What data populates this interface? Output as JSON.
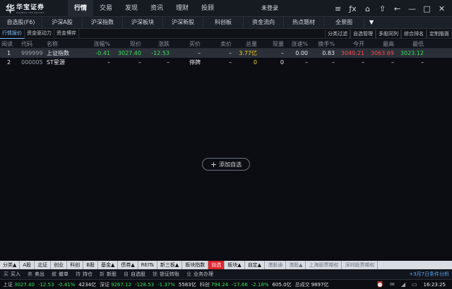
{
  "app": {
    "logo_mark": "华",
    "logo_cn": "华宝证券",
    "logo_en": "HUABAO SECURITIES"
  },
  "top_nav": [
    {
      "label": "行情",
      "active": true
    },
    {
      "label": "交易"
    },
    {
      "label": "发现"
    },
    {
      "label": "资讯"
    },
    {
      "label": "理财"
    },
    {
      "label": "投顾"
    }
  ],
  "login_label": "未登录",
  "window_icons": [
    "≡",
    "ƒx",
    "⌂",
    "⇧",
    "←",
    "—",
    "□",
    "✕"
  ],
  "categories": [
    "自选股(F6)",
    "沪深A股",
    "沪深指数",
    "沪深板块",
    "沪深新股",
    "科创板",
    "资金流向",
    "热点题材",
    "全景图"
  ],
  "category_more": "▼",
  "sub_tabs": [
    "行情报价",
    "资金驱动力",
    "资金博弈"
  ],
  "sub_right": [
    "分类过滤",
    "自选管理",
    "多股同列",
    "综合排名",
    "定制版面"
  ],
  "table": {
    "headers": [
      "阅读",
      "代码",
      "名称",
      "涨幅%",
      "现价",
      "涨跌",
      "买价",
      "卖价",
      "总量",
      "现量",
      "涨速%",
      "换手%",
      "今开",
      "最高",
      "最低"
    ],
    "rows": [
      {
        "idx": "1",
        "code": "999999",
        "name": "上证指数",
        "chg_pct": "-0.41",
        "price": "3027.40",
        "change": "-12.53",
        "bid": "–",
        "ask": "–",
        "volume": "3.77亿",
        "cur_vol": "–",
        "speed": "0.00",
        "turnover": "0.83",
        "open": "3040.21",
        "high": "3063.69",
        "low": "3023.12"
      },
      {
        "idx": "2",
        "code": "000005",
        "name": "ST星源",
        "chg_pct": "–",
        "price": "–",
        "change": "–",
        "bid": "停牌",
        "ask": "–",
        "volume": "0",
        "cur_vol": "0",
        "speed": "–",
        "turnover": "–",
        "open": "–",
        "high": "–",
        "low": "–"
      }
    ]
  },
  "add_watch_label": "添加自选",
  "bottom_tabs": [
    {
      "label": "分类▲"
    },
    {
      "label": "A股"
    },
    {
      "label": "北证"
    },
    {
      "label": "创业"
    },
    {
      "label": "科创"
    },
    {
      "label": "B股"
    },
    {
      "label": "基金▲"
    },
    {
      "label": "债券▲"
    },
    {
      "label": "REITs"
    },
    {
      "label": "新三板▲"
    },
    {
      "label": "板块指数"
    },
    {
      "label": "自选",
      "active": true
    },
    {
      "label": "板块▲"
    },
    {
      "label": "自定▲"
    },
    {
      "label": "港股通",
      "muted": true
    },
    {
      "label": "港股▲",
      "muted": true
    },
    {
      "label": "上海股票期权",
      "muted": true
    },
    {
      "label": "深圳股票期权",
      "muted": true
    }
  ],
  "toolbar": [
    {
      "icon": "买",
      "label": "买入"
    },
    {
      "icon": "卖",
      "label": "卖出"
    },
    {
      "icon": "撤",
      "label": "撤单"
    },
    {
      "icon": "持",
      "label": "持仓"
    },
    {
      "icon": "新",
      "label": "新股"
    },
    {
      "icon": "自",
      "label": "自选股"
    },
    {
      "icon": "锁",
      "label": "锁证转账"
    },
    {
      "icon": "业",
      "label": "业务办理"
    }
  ],
  "toolbar_note": "+3月7日条件分析",
  "status": {
    "sh_label": "上证",
    "sh_price": "3027.40",
    "sh_change": "-12.53",
    "sh_pct": "-0.41%",
    "sh_amount": "4234亿",
    "sz_label": "深证",
    "sz_price": "9267.12",
    "sz_change": "-128.53",
    "sz_pct": "-1.37%",
    "sz_amount": "5583亿",
    "kc_label": "科创",
    "kc_price": "794.24",
    "kc_change": "-17.66",
    "kc_pct": "-2.18%",
    "kc_amount": "605.0亿",
    "total_label": "总成交",
    "total_amount": "9897亿",
    "time": "16:23:25"
  },
  "colors": {
    "up": "#ff4a4a",
    "down": "#3adf5a",
    "accent": "#e0272f",
    "volume": "#f5d020"
  }
}
